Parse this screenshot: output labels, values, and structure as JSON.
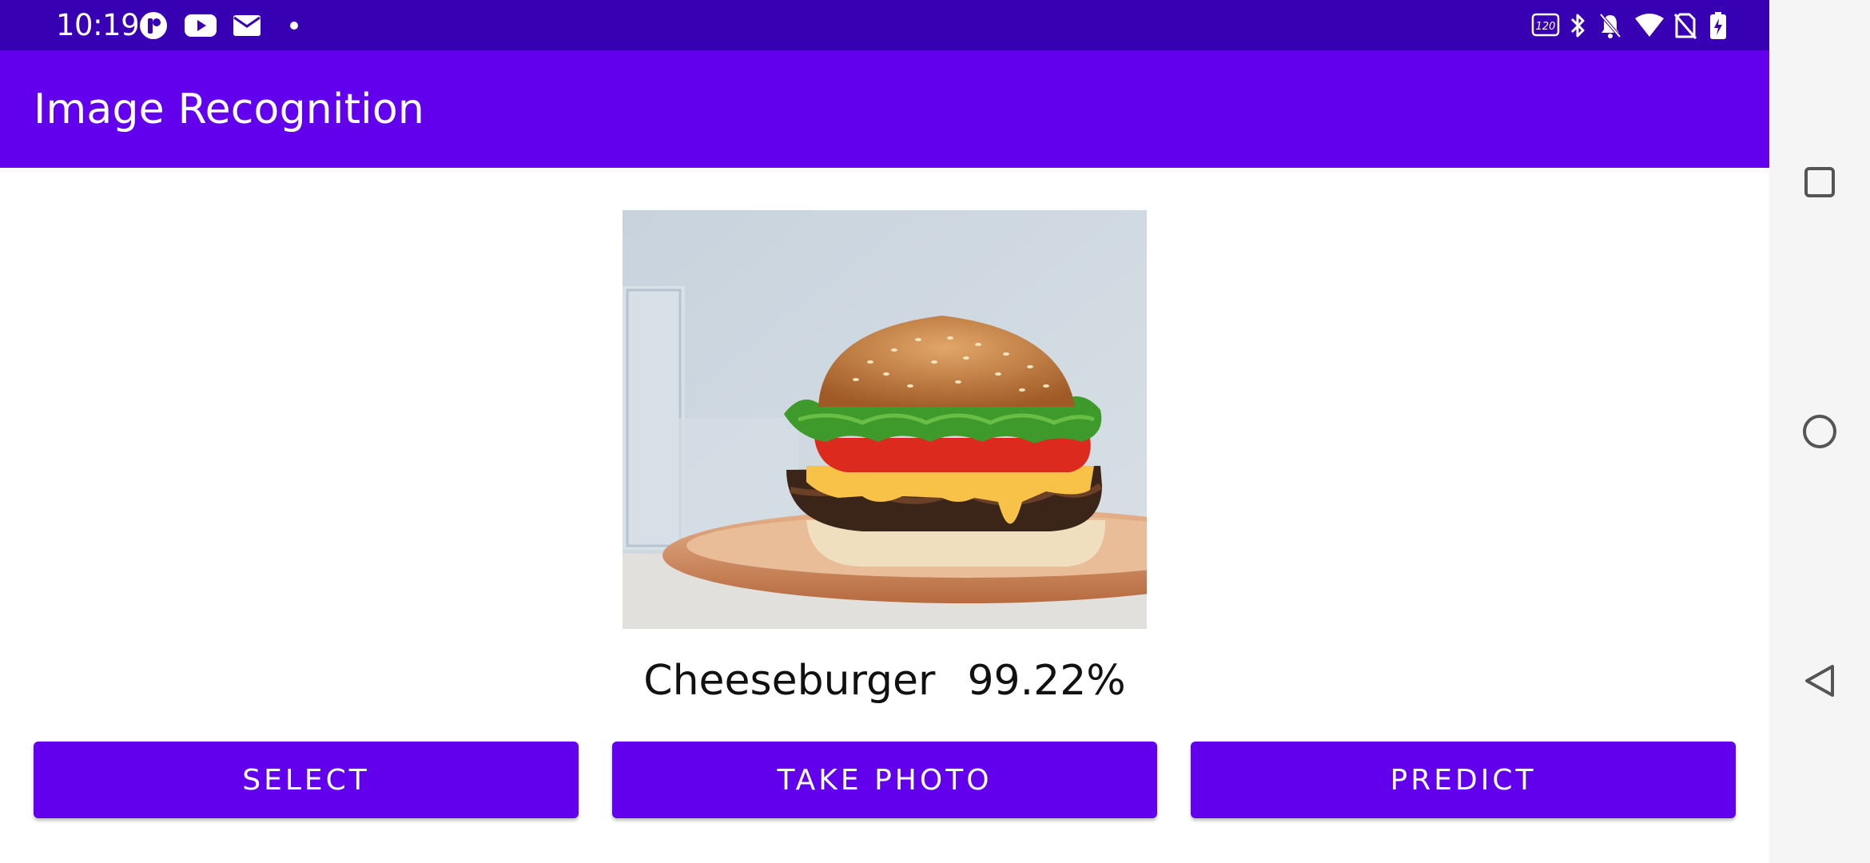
{
  "status_bar": {
    "time": "10:19",
    "left_icons": [
      "app-notification-icon",
      "youtube-icon",
      "mail-icon",
      "dot-icon"
    ],
    "right_icons": [
      "refresh-rate-120hz-icon",
      "bluetooth-icon",
      "notifications-off-icon",
      "wifi-icon",
      "no-sim-icon",
      "battery-charging-icon"
    ],
    "refresh_rate_label": "120"
  },
  "app_bar": {
    "title": "Image Recognition",
    "color": "#6200EE",
    "status_color": "#3700B3"
  },
  "main": {
    "image": {
      "subject": "cheeseburger on wooden plate"
    },
    "result": {
      "label": "Cheeseburger",
      "confidence": "99.22%"
    },
    "buttons": {
      "select": "SELECT",
      "take_photo": "TAKE PHOTO",
      "predict": "PREDICT"
    }
  },
  "nav_bar": {
    "buttons": [
      "recents-square-icon",
      "home-circle-icon",
      "back-triangle-icon"
    ]
  }
}
